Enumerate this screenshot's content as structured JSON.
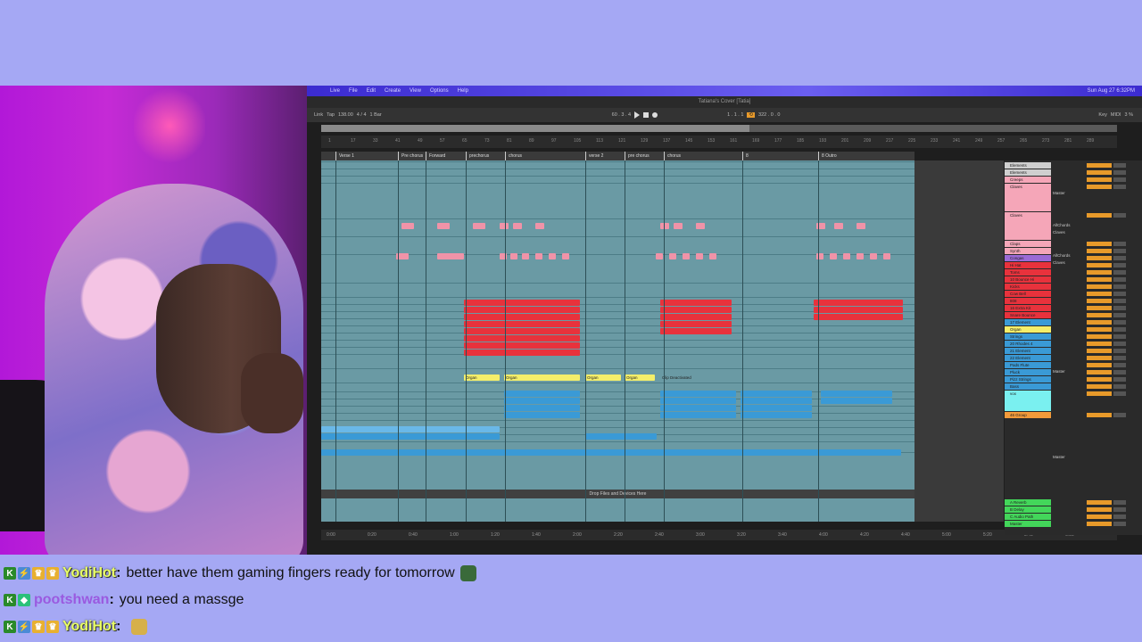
{
  "daw": {
    "menu": [
      "Live",
      "File",
      "Edit",
      "Create",
      "View",
      "Options",
      "Help"
    ],
    "clock": "Sun Aug 27 6:32PM",
    "title": "Tatiana's Cover [Tatia]",
    "transport": {
      "link": "Link",
      "tap": "Tap",
      "tempo": "138.00",
      "signature": "4 / 4",
      "quantize": "1 Bar",
      "position": "60 . 3 . 4",
      "loop_start": "1 . 1 . 1",
      "loop_length": "322 . 0 . 0",
      "key": "Key",
      "midi": "MIDI",
      "cpu": "3 %"
    },
    "ruler": [
      "1",
      "17",
      "33",
      "41",
      "49",
      "57",
      "65",
      "73",
      "81",
      "89",
      "97",
      "105",
      "113",
      "121",
      "129",
      "137",
      "145",
      "153",
      "161",
      "169",
      "177",
      "185",
      "193",
      "201",
      "209",
      "217",
      "225",
      "233",
      "241",
      "249",
      "257",
      "265",
      "273",
      "281",
      "289"
    ],
    "locators": [
      {
        "label": "Verse 1"
      },
      {
        "label": "Pre chorus"
      },
      {
        "label": "Forward"
      },
      {
        "label": "prechorus"
      },
      {
        "label": "chorus"
      },
      {
        "label": "verse 2"
      },
      {
        "label": "pre chorus"
      },
      {
        "label": "chorus"
      },
      {
        "label": "8"
      },
      {
        "label": "8 Outro"
      }
    ],
    "clip_labels": {
      "organ": "Organ",
      "clip_deactivated": "Clip Deactivated",
      "drop_zone": "Drop Files and Devices Here"
    },
    "timebar": [
      "0:00",
      "0:20",
      "0:40",
      "1:00",
      "1:20",
      "1:40",
      "2:00",
      "2:20",
      "2:40",
      "3:00",
      "3:20",
      "3:40",
      "4:00",
      "4:20",
      "4:40",
      "5:00",
      "5:20",
      "5:40",
      "6:00"
    ],
    "tracks": [
      {
        "name": "Elements",
        "color": "grey"
      },
      {
        "name": "Elements",
        "color": "grey"
      },
      {
        "name": "Creeps",
        "color": "pink"
      },
      {
        "name": "Claves",
        "color": "pink"
      },
      {
        "name": "Claves",
        "color": "pink"
      },
      {
        "name": "Claps",
        "color": "pink"
      },
      {
        "name": "Synth",
        "color": "pink"
      },
      {
        "name": "Congas",
        "color": "purple"
      },
      {
        "name": "Hi Hat",
        "color": "red"
      },
      {
        "name": "Toms",
        "color": "red"
      },
      {
        "name": "10 Bounce Hi",
        "color": "red"
      },
      {
        "name": "Kicks",
        "color": "red"
      },
      {
        "name": "Cow Bell",
        "color": "red"
      },
      {
        "name": "808",
        "color": "red"
      },
      {
        "name": "16 Extra Kit",
        "color": "red"
      },
      {
        "name": "Snare Bounce",
        "color": "red"
      },
      {
        "name": "17 Element",
        "color": "blue"
      },
      {
        "name": "Organ",
        "color": "yellow"
      },
      {
        "name": "Strings",
        "color": "blue"
      },
      {
        "name": "20 Rhodes 4",
        "color": "blue"
      },
      {
        "name": "21 Element",
        "color": "blue"
      },
      {
        "name": "22 Element",
        "color": "blue"
      },
      {
        "name": "Pads Flute",
        "color": "blue"
      },
      {
        "name": "Pluck",
        "color": "blue"
      },
      {
        "name": "Pizz Strings",
        "color": "blue"
      },
      {
        "name": "Bass",
        "color": "blue"
      },
      {
        "name": "vox",
        "color": "cyan"
      },
      {
        "name": "46 Group",
        "color": "orange"
      },
      {
        "name": "A Reverb",
        "color": "green"
      },
      {
        "name": "B Delay",
        "color": "green"
      },
      {
        "name": "C Audio Path",
        "color": "green"
      },
      {
        "name": "Master",
        "color": "green"
      }
    ],
    "sends": {
      "master": "Master",
      "all_chords": "AllChords",
      "claves": "Claves"
    }
  },
  "chat": [
    {
      "user": "YodiHot",
      "user_color": "yellow",
      "badges": [
        "k",
        "b",
        "gold",
        "gold"
      ],
      "message": "better have them gaming fingers ready for tomorrow",
      "emote": "frog"
    },
    {
      "user": "pootshwan",
      "user_color": "purple",
      "badges": [
        "k",
        "diamond"
      ],
      "message": "you need a massge",
      "emote": ""
    },
    {
      "user": "YodiHot",
      "user_color": "yellow",
      "badges": [
        "k",
        "b",
        "gold",
        "gold"
      ],
      "message": "",
      "emote": "hand"
    }
  ]
}
